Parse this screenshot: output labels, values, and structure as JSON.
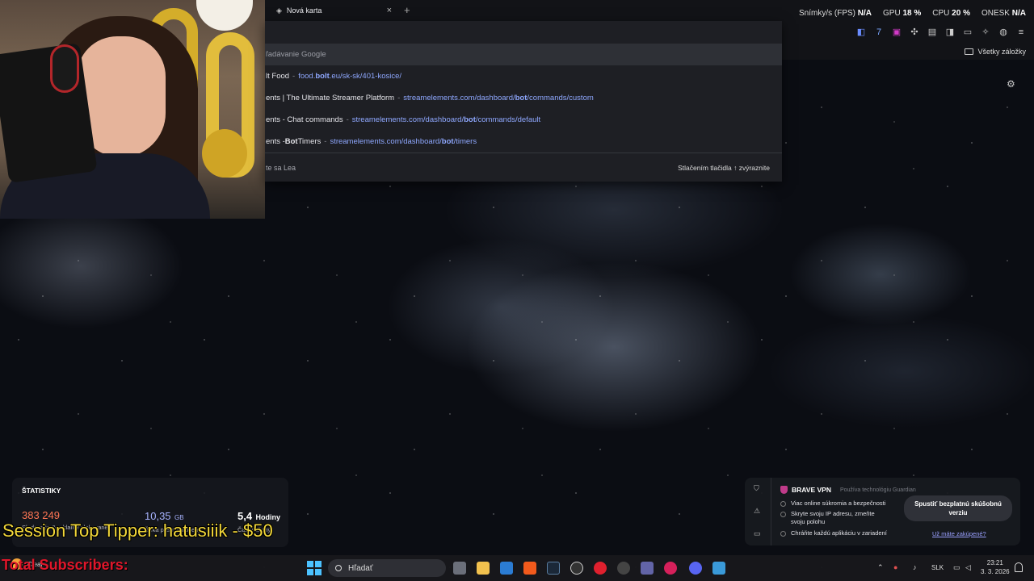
{
  "browser": {
    "tab_title": "Nová karta",
    "tab_close": "×",
    "new_tab": "+",
    "bookmarks_label": "Všetky záložky"
  },
  "perf_overlay": {
    "fps_label": "Snímky/s (FPS)",
    "fps_value": "N/A",
    "gpu_label": "GPU",
    "gpu_value": "18 %",
    "cpu_label": "CPU",
    "cpu_value": "20 %",
    "latency_label": "ONESK",
    "latency_value": "N/A"
  },
  "omnibox": {
    "search_suggestion": "ľadávanie Google",
    "suggestions": [
      {
        "title_pre": "lt Food",
        "title_bold": "",
        "title_post": "",
        "url_pre": "food.",
        "url_bold": "bolt",
        "url_post": ".eu/sk-sk/401-kosice/"
      },
      {
        "title_pre": "ents | The Ultimate Streamer Platform",
        "title_bold": "",
        "title_post": "",
        "url_pre": "streamelements.com/dashboard/",
        "url_bold": "bot",
        "url_post": "/commands/custom"
      },
      {
        "title_pre": "ents - Chat commands",
        "title_bold": "",
        "title_post": "",
        "url_pre": "streamelements.com/dashboard/",
        "url_bold": "bot",
        "url_post": "/commands/default"
      },
      {
        "title_pre": "ents - ",
        "title_bold": "Bot",
        "title_post": " Timers",
        "url_pre": "streamelements.com/dashboard/",
        "url_bold": "bot",
        "url_post": "/timers"
      }
    ],
    "footer_left": "te sa Lea",
    "footer_hint": "Stlačením tlačidla ↑ zvýraznite"
  },
  "stats_widget": {
    "title": "ŠTATISTIKY",
    "trackers_value": "383 249",
    "trackers_label": "Sledovače & reklamy blokované",
    "bandwidth_value": "10,35",
    "bandwidth_unit": "GB",
    "bandwidth_label": "Šírka pásma uložený",
    "time_value": "5,4",
    "time_unit": "Hodiny",
    "time_label": "Čas uložený"
  },
  "overlays": {
    "top_tipper": "Session Top Tipper: hatusiiik - $50",
    "subscribers": "Total Subscribers:"
  },
  "vpn_card": {
    "title": "BRAVE VPN",
    "powered_by": "Používa technológiu Guardian",
    "features": [
      "Viac online súkromia a bezpečnosti",
      "Skryte svoju IP adresu, zmeňte svoju polohu",
      "Chráňte každú aplikáciu v zariadení"
    ],
    "cta": "Spustiť bezplatnú skúšobnú verziu",
    "already_bought": "Už máte zakúpené?"
  },
  "taskbar": {
    "weather": "Clear",
    "search_placeholder": "Hľadať",
    "language": "SLK",
    "time": "23:21",
    "date": "3. 3. 2026"
  },
  "colors": {
    "accent_link": "#8fa8ff",
    "trackers": "#ff7654",
    "tipper": "#f3d83a",
    "subscribers": "#e0162a",
    "windows_blue": "#4cc2ff"
  }
}
